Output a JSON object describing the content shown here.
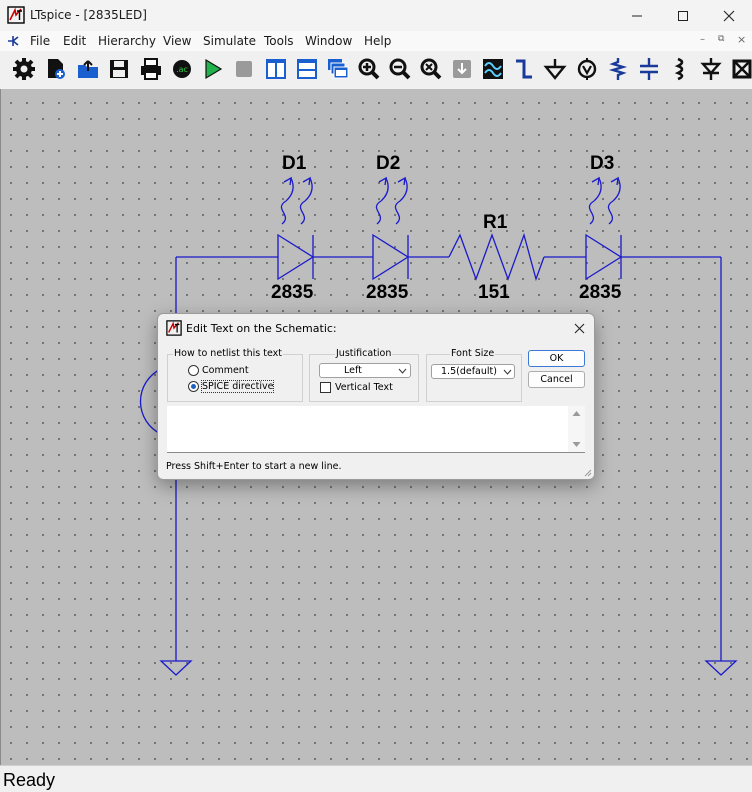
{
  "window": {
    "title": "LTspice - [2835LED]"
  },
  "menu": [
    "File",
    "Edit",
    "Hierarchy",
    "View",
    "Simulate",
    "Tools",
    "Window",
    "Help"
  ],
  "toolbar_icons": [
    "settings-icon",
    "new-schematic-icon",
    "open-icon",
    "save-icon",
    "print-icon",
    "ac-analysis-icon",
    "run-icon",
    "halt-icon",
    "tile-vertical-icon",
    "tile-horizontal-icon",
    "cascade-icon",
    "zoom-in-icon",
    "zoom-out-icon",
    "zoom-fit-icon",
    "autoscale-icon",
    "waveform-icon",
    "wire-icon",
    "ground-icon",
    "label-net-icon",
    "resistor-icon",
    "capacitor-icon",
    "inductor-icon",
    "diode-icon",
    "component-icon"
  ],
  "schematic": {
    "components": [
      {
        "ref": "D1",
        "value": "2835"
      },
      {
        "ref": "D2",
        "value": "2835"
      },
      {
        "ref": "R1",
        "value": "151"
      },
      {
        "ref": "D3",
        "value": "2835"
      }
    ]
  },
  "dialog": {
    "title": "Edit Text on the Schematic:",
    "netlist_group": {
      "label": "How to netlist this text",
      "options": [
        "Comment",
        "SPICE directive"
      ],
      "selected": "SPICE directive"
    },
    "justification": {
      "label": "Justification",
      "value": "Left",
      "vertical_text_label": "Vertical Text",
      "vertical_text_checked": false
    },
    "font_size": {
      "label": "Font Size",
      "value": "1.5(default)"
    },
    "ok_label": "OK",
    "cancel_label": "Cancel",
    "text_value": "",
    "hint": "Press Shift+Enter to start a new line."
  },
  "status": {
    "text": "Ready"
  },
  "colors": {
    "wire": "#1a1acc",
    "canvas": "#bdbdbd",
    "radio_selected": "#1f5fbf"
  }
}
